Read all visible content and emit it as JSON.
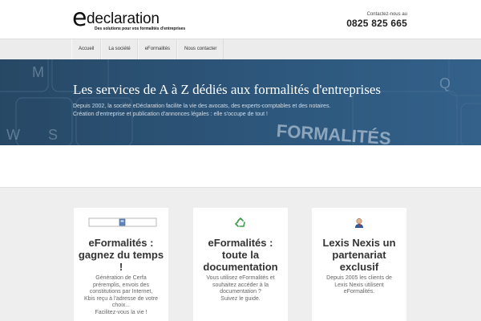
{
  "header": {
    "logo_letter": "e",
    "logo_word": "declaration",
    "logo_tagline": "Des solutions pour vos formalités d'entreprises",
    "contact_label": "Contactez-nous au",
    "contact_phone": "0825 825 665"
  },
  "nav": {
    "items": [
      {
        "label": "Accueil"
      },
      {
        "label": "La société"
      },
      {
        "label": "eFormalités"
      },
      {
        "label": "Nous contacter"
      }
    ]
  },
  "hero": {
    "title": "Les services de A à Z dédiés aux formalités d'entreprises",
    "subtitle_line1": "Depuis 2002, la société eDéclaration facilite la vie des avocats, des experts-comptables et des notaires.",
    "subtitle_line2": "Création d'entreprise et publication d'annonces légales : elle s'occupe de tout !",
    "background_text": "FORMALITÉS",
    "background_letters": [
      "M",
      "Q",
      "S",
      "W"
    ]
  },
  "cards": [
    {
      "icon": "broken-image-icon",
      "title": "eFormalités : gagnez du temps !",
      "text": [
        "Génération de Cerfa",
        "préremplis, envois des",
        "constitutions par Internet,",
        "Kbis reçu à l'adresse de votre",
        "choix...",
        "Facilitez-vous la vie !"
      ]
    },
    {
      "icon": "recycle-icon",
      "title": "eFormalités : toute la documentation",
      "text": [
        "Vous utilisez eFormalités et",
        "souhaitez accéder à la",
        "documentation ?",
        "Suivez le guide."
      ]
    },
    {
      "icon": "person-icon",
      "title": "Lexis Nexis un partenariat exclusif",
      "text": [
        "Depuis 2005 les clients de",
        "Lexis Nexis utilisent",
        "eFormalités."
      ]
    }
  ],
  "colors": {
    "hero_blue": "#2c5478",
    "recycle_green": "#3a9a4a",
    "person_blue": "#2a5aa0",
    "person_red": "#c0392b"
  }
}
